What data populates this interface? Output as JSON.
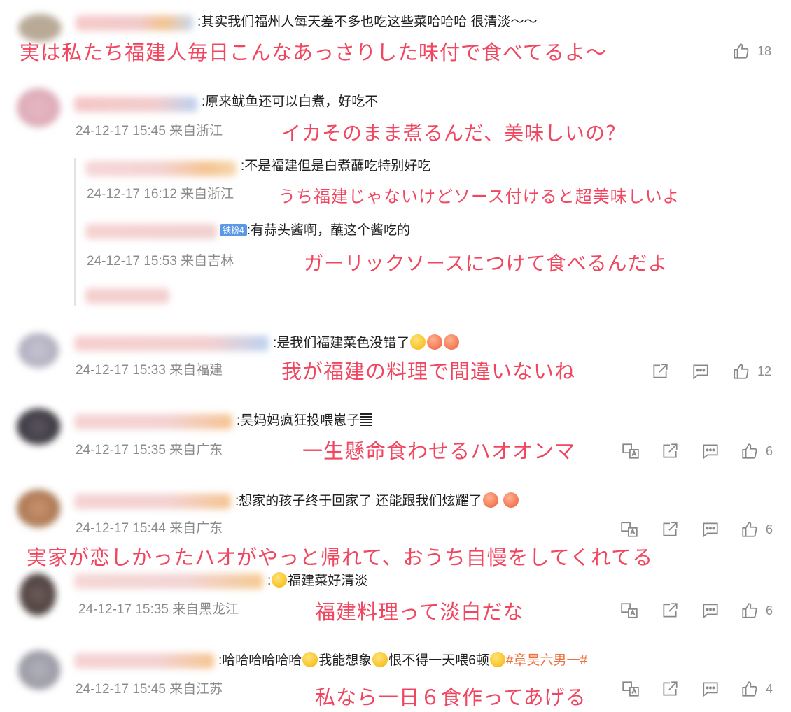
{
  "comments": [
    {
      "text": ":其实我们福州人每天差不多也吃这些菜哈哈哈 很清淡～～",
      "translation": "実は私たち福建人毎日こんなあっさりした味付で食べてるよ～",
      "likes": "18"
    },
    {
      "text": ":原来鱿鱼还可以白煮，好吃不",
      "meta": "24-12-17 15:45 来自浙江",
      "translation": "イカそのまま煮るんだ、美味しいの？",
      "replies": [
        {
          "text": ":不是福建但是白煮蘸吃特别好吃",
          "meta": "24-12-17 16:12 来自浙江",
          "translation": "うち福建じゃないけどソース付けると超美味しいよ"
        },
        {
          "badge": "铁粉4",
          "text": ":有蒜头酱啊，蘸这个酱吃的",
          "meta": "24-12-17 15:53 来自吉林",
          "translation": "ガーリックソースにつけて食べるんだよ"
        }
      ]
    },
    {
      "text": ":是我们福建菜色没错了",
      "meta": "24-12-17 15:33 来自福建",
      "translation": "我が福建の料理で間違いないね",
      "likes": "12"
    },
    {
      "text": ":昊妈妈疯狂投喂崽子",
      "meta": "24-12-17 15:35 来自广东",
      "translation": "一生懸命食わせるハオオンマ",
      "likes": "6"
    },
    {
      "text": ":想家的孩子终于回家了 还能跟我们炫耀了",
      "meta": "24-12-17 15:44 来自广东",
      "translation": "実家が恋しかったハオがやっと帰れて、おうち自慢をしてくれてる",
      "likes": "6"
    },
    {
      "text": "福建菜好清淡",
      "meta": "24-12-17 15:35 来自黑龙江",
      "translation": "福建料理って淡白だな",
      "likes": "6"
    },
    {
      "text_a": ":哈哈哈哈哈哈",
      "text_b": "我能想象",
      "text_c": "恨不得一天喂6顿",
      "hashtag": "#章昊六男一#",
      "meta": "24-12-17 15:45 来自江苏",
      "translation": "私なら一日６食作ってあげる",
      "likes": "4"
    }
  ],
  "icons": {
    "like": "thumbs-up-icon",
    "share": "share-icon",
    "comment": "comment-icon",
    "translate": "translate-icon"
  },
  "colors": {
    "translation": "#f0465f",
    "meta": "#8a8a8a",
    "hashtag": "#eb7340",
    "badge": "#5c98e8"
  }
}
